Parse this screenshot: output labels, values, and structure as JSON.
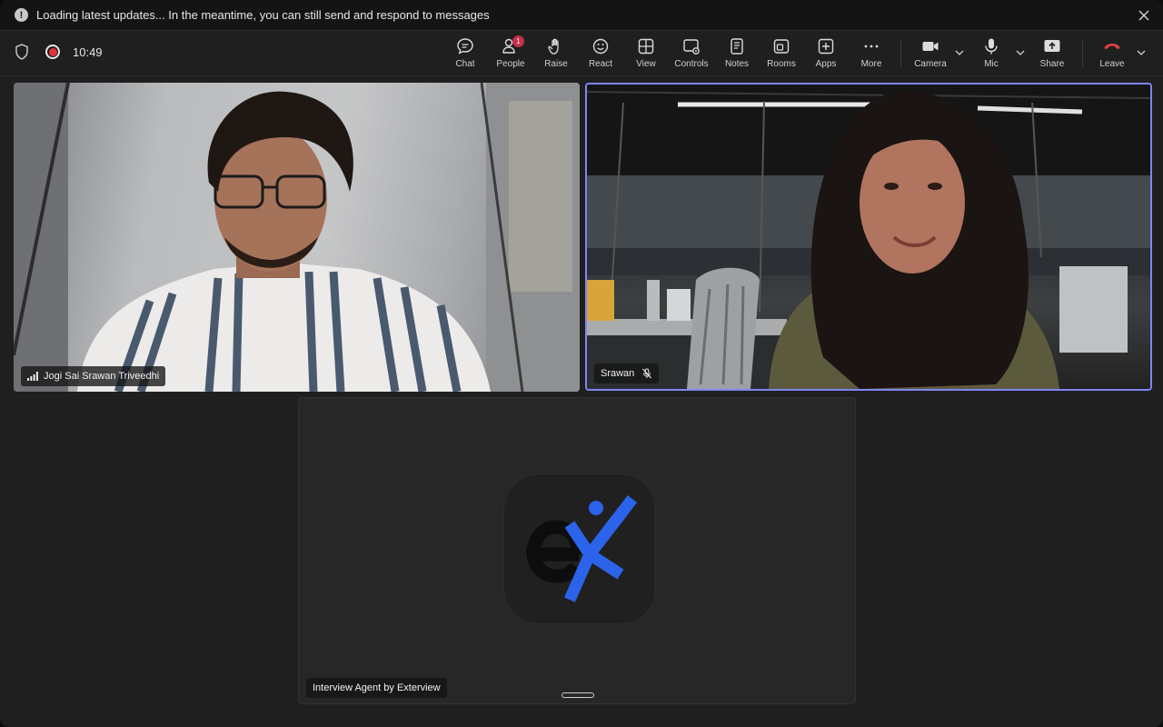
{
  "banner": {
    "message": "Loading latest updates... In the meantime, you can still send and respond to messages"
  },
  "meeting": {
    "timer": "10:49"
  },
  "toolbar": {
    "items": [
      {
        "label": "Chat"
      },
      {
        "label": "People",
        "badge": "1"
      },
      {
        "label": "Raise"
      },
      {
        "label": "React"
      },
      {
        "label": "View"
      },
      {
        "label": "Controls"
      },
      {
        "label": "Notes"
      },
      {
        "label": "Rooms"
      },
      {
        "label": "Apps"
      },
      {
        "label": "More"
      },
      {
        "label": "Camera"
      },
      {
        "label": "Mic"
      },
      {
        "label": "Share"
      },
      {
        "label": "Leave"
      }
    ]
  },
  "participants": [
    {
      "name": "Jogi Sai Srawan Triveedhi"
    },
    {
      "name": "Srawan"
    },
    {
      "name": "Interview Agent by Exterview"
    }
  ],
  "colors": {
    "accent": "#7f85f5",
    "leave": "#e3423f",
    "badge": "#c4314b",
    "logo_blue": "#2b63ea"
  }
}
